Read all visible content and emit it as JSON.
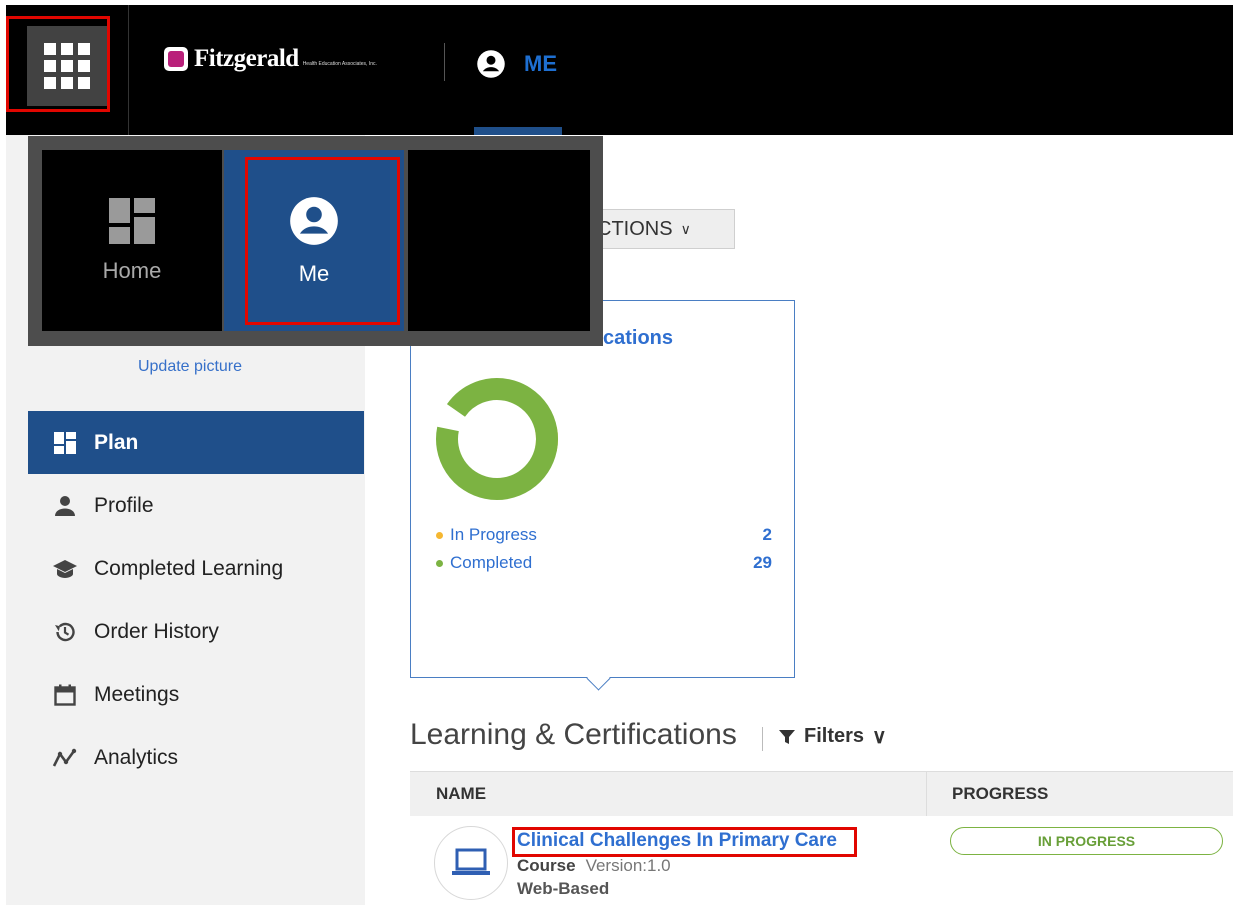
{
  "header": {
    "brand_name": "Fitzgerald",
    "brand_sub": "Health Education Associates, Inc.",
    "me_label": "ME"
  },
  "app_switcher": {
    "tiles": [
      {
        "label": "Home",
        "icon": "dashboard-icon"
      },
      {
        "label": "Me",
        "icon": "account-circle-icon"
      }
    ]
  },
  "sidebar": {
    "update_picture": "Update picture",
    "items": [
      {
        "label": "Plan",
        "icon": "dashboard-icon",
        "active": true
      },
      {
        "label": "Profile",
        "icon": "person-icon"
      },
      {
        "label": "Completed Learning",
        "icon": "graduation-cap-icon"
      },
      {
        "label": "Order History",
        "icon": "history-icon"
      },
      {
        "label": "Meetings",
        "icon": "calendar-icon"
      },
      {
        "label": "Analytics",
        "icon": "analytics-icon"
      }
    ]
  },
  "actions_button": {
    "label": "CTIONS"
  },
  "card": {
    "title": "cations",
    "chart_data": {
      "type": "pie",
      "categories": [
        "In Progress",
        "Completed"
      ],
      "values": [
        2,
        29
      ]
    },
    "legend": [
      {
        "label": "In Progress",
        "value": "2",
        "color": "#f5b731"
      },
      {
        "label": "Completed",
        "value": "29",
        "color": "#7cb342"
      }
    ]
  },
  "section": {
    "title": "Learning & Certifications",
    "filters_label": "Filters"
  },
  "table": {
    "headers": [
      "NAME",
      "PROGRESS"
    ],
    "rows": [
      {
        "title": "Clinical Challenges In Primary Care",
        "type": "Course",
        "version": "Version:1.0",
        "delivery": "Web-Based",
        "status": "IN PROGRESS"
      }
    ]
  },
  "colors": {
    "accent": "#1f4f8a",
    "link": "#2f6fd0",
    "highlight": "#e10600"
  }
}
